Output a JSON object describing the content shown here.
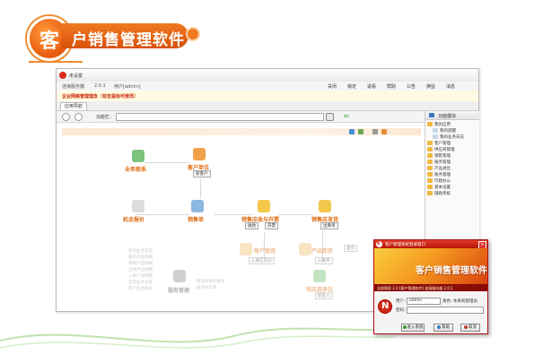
{
  "banner": {
    "badge": "客",
    "title": "户销售管理软件"
  },
  "window": {
    "title": "未设置",
    "info": {
      "company": "连接服务器",
      "version": "2.0.1",
      "user": "用户[admin]"
    },
    "menu": [
      "关闭",
      "锁定",
      "退看",
      "帮助",
      "公告",
      "换监",
      "消息"
    ],
    "slogan": "企业网络管理理念（双击鼠标可修改）",
    "tab": "应用导航",
    "toolbar": {
      "nav_label": "功能栏：",
      "nav_select_value": ""
    }
  },
  "flow": {
    "nodes": [
      {
        "label": "业务联系"
      },
      {
        "label": "客户单位",
        "button": "新客户"
      },
      {
        "label": "机会报价"
      },
      {
        "label": "销售单"
      },
      {
        "label": "销售应收与开票",
        "buttons": [
          "收款",
          "开票"
        ]
      },
      {
        "label": "销售应发货",
        "button": "出库单"
      }
    ],
    "lower": {
      "account": {
        "label": "账户管理",
        "sub": "入库应支付"
      },
      "stock": {
        "label": "产品库存",
        "side": "盘点",
        "sub": "入库单"
      },
      "supplier": {
        "label": "供应商单位",
        "sub": "新客人"
      },
      "service": {
        "label": "服务管理",
        "items": [
          "管理对象的服务",
          "服务知识库"
        ]
      },
      "left_list": [
        "新的业务日志",
        "服务产品明细",
        "采购产品明细",
        "出库产品明细",
        "入库产品明细",
        "其他业务往来",
        "客户业务统计"
      ]
    }
  },
  "sidebar": {
    "title": "功能模块",
    "items": [
      {
        "label": "我的应用"
      },
      {
        "label": "我的提醒"
      },
      {
        "label": "我的业务日志"
      },
      {
        "label": "客户管理"
      },
      {
        "label": "供应商管理"
      },
      {
        "label": "销售管理"
      },
      {
        "label": "服务管理"
      },
      {
        "label": "产品进出"
      },
      {
        "label": "账务管理"
      },
      {
        "label": "行政办公"
      },
      {
        "label": "基本设置"
      },
      {
        "label": "辅助系统"
      }
    ]
  },
  "dialog": {
    "title": "客户管理系统登录窗口",
    "banner_title": "客户销售管理软件",
    "version_line": "全部版权 2.0 [客户管理软件] 连接服务器 2.0.1",
    "user_label": "用户：",
    "user_value": "admin",
    "role_label": "角色：",
    "role_value": "本系统管理员",
    "password_label": "密码：",
    "password_value": "",
    "buttons": {
      "login": "进入系统",
      "help": "帮助",
      "cancel": "取消"
    }
  },
  "colors": {
    "brand": "#e8590c",
    "dialog_red": "#b71608",
    "accent_green": "#2a9a2a"
  }
}
